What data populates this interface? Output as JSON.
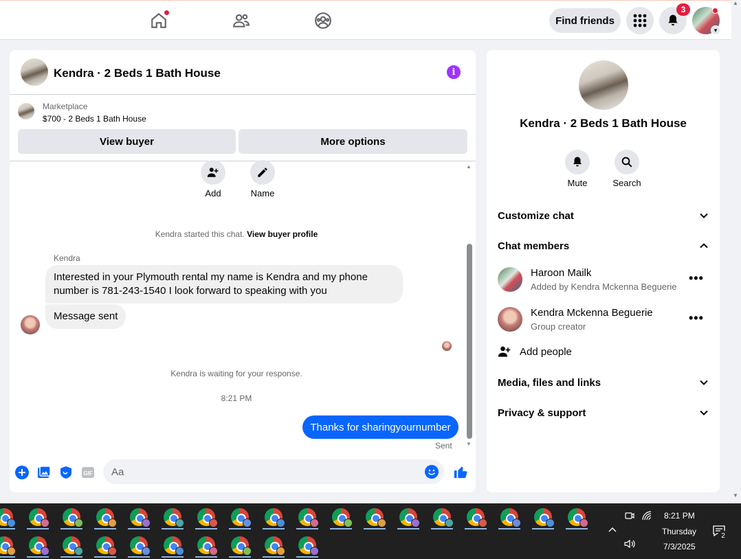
{
  "topbar": {
    "find_friends_label": "Find friends",
    "notification_count": "3"
  },
  "chat": {
    "title": "Kendra · 2 Beds 1 Bath House",
    "marketplace_label": "Marketplace",
    "listing": "$700 - 2 Beds 1 Bath House",
    "view_buyer_label": "View buyer",
    "more_options_label": "More options",
    "actions": [
      {
        "label": "Add",
        "icon": "add-person-icon"
      },
      {
        "label": "Name",
        "icon": "pencil-icon"
      }
    ],
    "started_text": "Kendra started this chat.",
    "view_buyer_profile": "View buyer profile",
    "sender_name": "Kendra",
    "message_1": "Interested in your Plymouth rental my name is Kendra and my phone number is 781-243-1540 I look forward to speaking with you",
    "message_2": "Message sent",
    "waiting_text": "Kendra is waiting for your response.",
    "timestamp": "8:21 PM",
    "outgoing_message": "Thanks for sharingyournumber",
    "sent_status": "Sent",
    "composer_placeholder": "Aa",
    "colors": {
      "accent": "#0866ff",
      "info": "#a033ff"
    }
  },
  "side": {
    "title": "Kendra · 2 Beds 1 Bath House",
    "mute_label": "Mute",
    "search_label": "Search",
    "customize_chat": "Customize chat",
    "chat_members": "Chat members",
    "members": [
      {
        "name": "Haroon Mailk",
        "sub": "Added by Kendra Mckenna Beguerie"
      },
      {
        "name": "Kendra Mckenna Beguerie",
        "sub": "Group creator"
      }
    ],
    "add_people": "Add people",
    "media_files_links": "Media, files and links",
    "privacy_support": "Privacy & support"
  },
  "taskbar": {
    "time": "8:21 PM",
    "day": "Thursday",
    "date": "7/3/2025",
    "notification_count": "2"
  }
}
